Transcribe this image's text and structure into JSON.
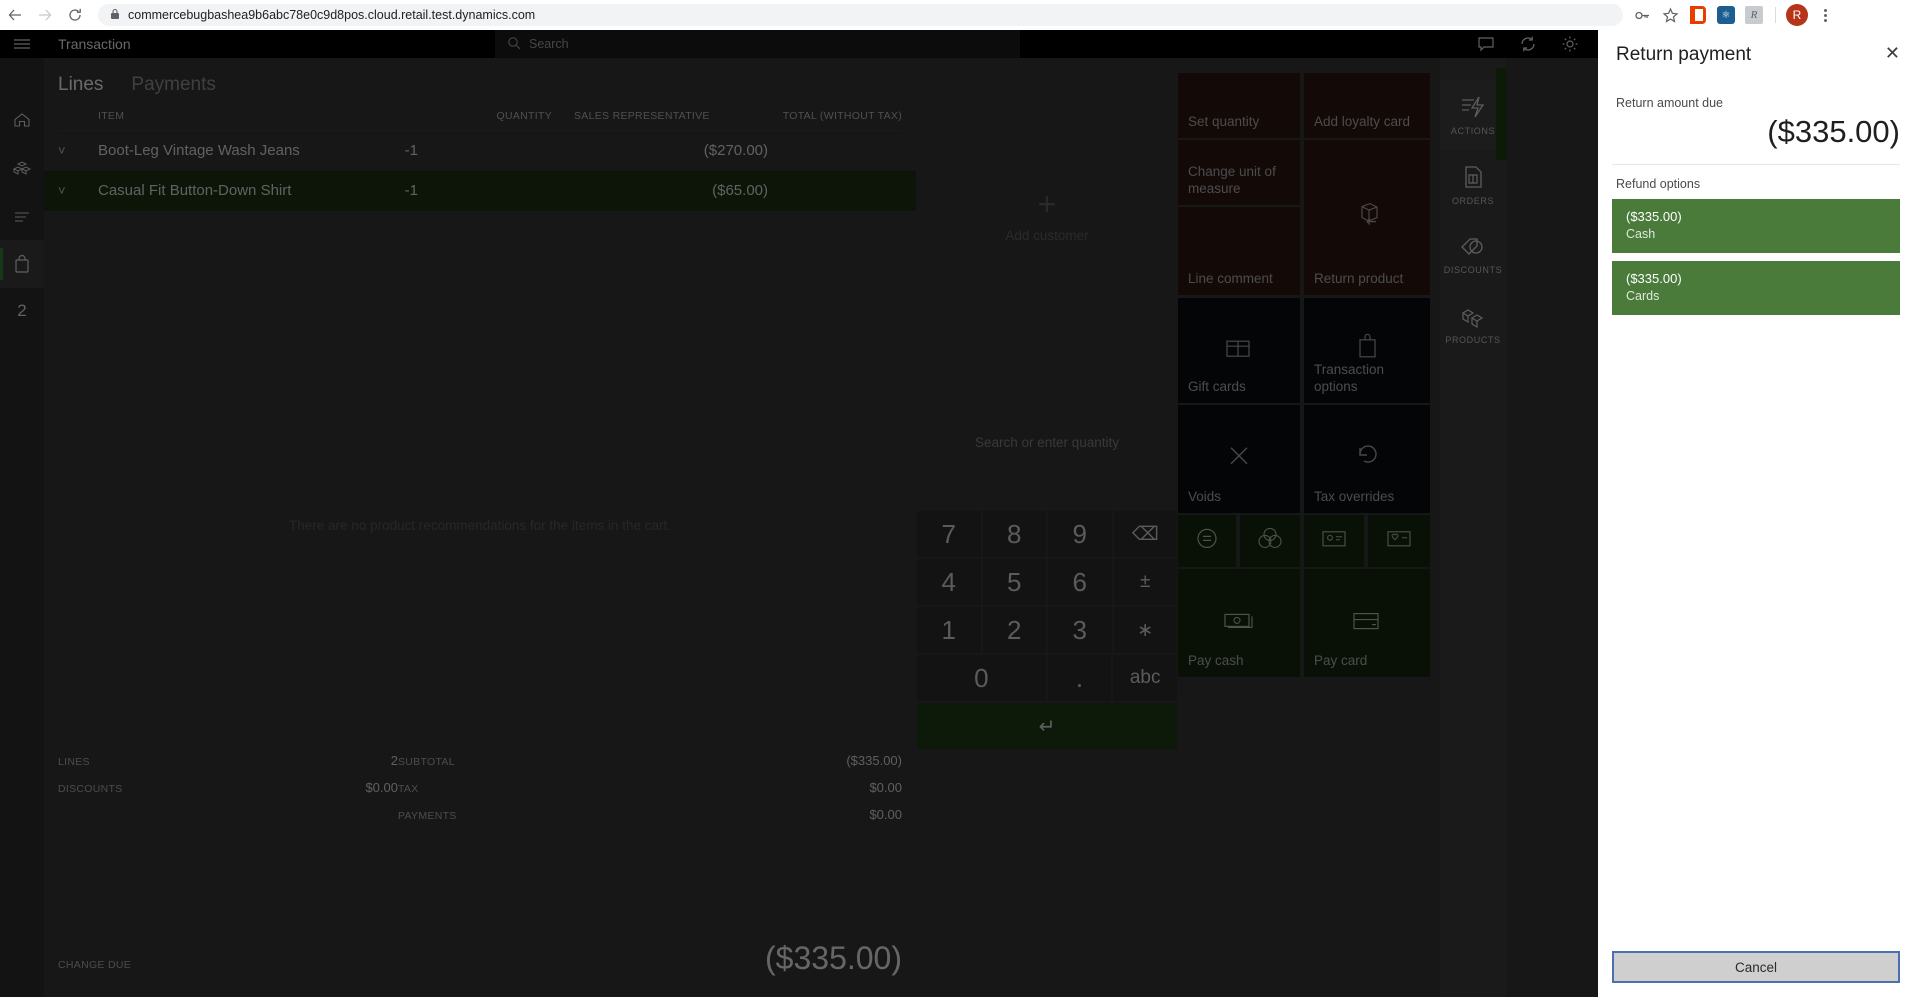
{
  "browser": {
    "back_icon": "back-arrow-icon",
    "forward_icon": "forward-arrow-icon",
    "reload_icon": "reload-icon",
    "lock_icon": "lock-icon",
    "url": "commercebugbashea9b6abc78e0c9d8pos.cloud.retail.test.dynamics.com",
    "key_icon": "key-icon",
    "star_icon": "star-icon",
    "ext_office": "office-extension-icon",
    "ext_blue": "shield-extension-icon",
    "ext_gray": "script-extension-icon",
    "profile_initial": "R",
    "menu_icon": "kebab-menu-icon"
  },
  "rail": {
    "hamburger": "hamburger-icon",
    "items": [
      {
        "icon": "home-icon",
        "name": "home"
      },
      {
        "icon": "products-icon",
        "name": "products"
      },
      {
        "icon": "list-icon",
        "name": "list"
      },
      {
        "icon": "cart-icon",
        "name": "cart"
      }
    ],
    "count": "2"
  },
  "appbar": {
    "title": "Transaction",
    "search_placeholder": "Search",
    "search_icon": "search-icon",
    "icons": [
      "chat-icon",
      "sync-icon",
      "gear-icon"
    ]
  },
  "cart": {
    "tabs": [
      {
        "label": "Lines",
        "active": true
      },
      {
        "label": "Payments",
        "active": false
      }
    ],
    "columns": {
      "item": "ITEM",
      "quantity": "QUANTITY",
      "sales_rep": "SALES REPRESENTATIVE",
      "total": "TOTAL (WITHOUT TAX)"
    },
    "rows": [
      {
        "item": "Boot-Leg Vintage Wash Jeans",
        "qty": "-1",
        "rep": "",
        "total": "($270.00)",
        "selected": false
      },
      {
        "item": "Casual Fit Button-Down Shirt",
        "qty": "-1",
        "rep": "",
        "total": "($65.00)",
        "selected": true
      }
    ],
    "no_recommendations": "There are no product recommendations for the items in the cart.",
    "totals_left": [
      {
        "key": "LINES",
        "value": "2"
      },
      {
        "key": "DISCOUNTS",
        "value": "$0.00"
      }
    ],
    "totals_right": [
      {
        "key": "SUBTOTAL",
        "value": "($335.00)"
      },
      {
        "key": "TAX",
        "value": "$0.00"
      },
      {
        "key": "PAYMENTS",
        "value": "$0.00"
      }
    ],
    "change_due_label": "CHANGE DUE",
    "change_due_value": "($335.00)"
  },
  "customer": {
    "plus": "+",
    "label": "Add customer"
  },
  "keypad": {
    "hint": "Search or enter quantity",
    "keys": [
      "7",
      "8",
      "9",
      "⌫",
      "4",
      "5",
      "6",
      "±",
      "1",
      "2",
      "3",
      "∗",
      "0",
      ".",
      "abc"
    ],
    "enter": "↵"
  },
  "tiles": [
    {
      "label": "Set quantity",
      "style": "red",
      "icon": ""
    },
    {
      "label": "Add loyalty card",
      "style": "red",
      "icon": ""
    },
    {
      "label": "Change unit of measure",
      "style": "red",
      "icon": ""
    },
    {
      "label": "Return product",
      "style": "red",
      "icon": "return-box-icon"
    },
    {
      "label": "Line comment",
      "style": "red",
      "icon": ""
    },
    {
      "label": "Gift cards",
      "style": "dark",
      "icon": "gift-card-icon"
    },
    {
      "label": "Transaction options",
      "style": "dark",
      "icon": "bag-icon"
    },
    {
      "label": "Voids",
      "style": "dark",
      "icon": "close-x-icon"
    },
    {
      "label": "Tax overrides",
      "style": "dark",
      "icon": "undo-icon"
    },
    {
      "label": "",
      "style": "green",
      "icon": "equals-circle-icon"
    },
    {
      "label": "",
      "style": "green",
      "icon": "coins-icon"
    },
    {
      "label": "",
      "style": "green",
      "icon": "id-card-icon"
    },
    {
      "label": "",
      "style": "green",
      "icon": "loyalty-card-icon"
    },
    {
      "label": "Pay cash",
      "style": "green",
      "icon": "cash-icon"
    },
    {
      "label": "Pay card",
      "style": "green",
      "icon": "credit-card-icon"
    }
  ],
  "iconrail": [
    {
      "caption": "ACTIONS",
      "icon": "actions-icon"
    },
    {
      "caption": "ORDERS",
      "icon": "orders-icon"
    },
    {
      "caption": "DISCOUNTS",
      "icon": "discounts-icon"
    },
    {
      "caption": "PRODUCTS",
      "icon": "products-cube-icon"
    }
  ],
  "panel": {
    "title": "Return payment",
    "close_icon": "close-icon",
    "amount_label": "Return amount due",
    "amount_value": "($335.00)",
    "options_label": "Refund options",
    "options": [
      {
        "amount": "($335.00)",
        "name": "Cash"
      },
      {
        "amount": "($335.00)",
        "name": "Cards"
      }
    ],
    "cancel_label": "Cancel"
  },
  "colors": {
    "accent_green": "#4a7b3a",
    "selected_row": "#1c3012",
    "panel_bg": "#ffffff",
    "app_bg": "#333333",
    "focus_border": "#4a6fb5"
  }
}
